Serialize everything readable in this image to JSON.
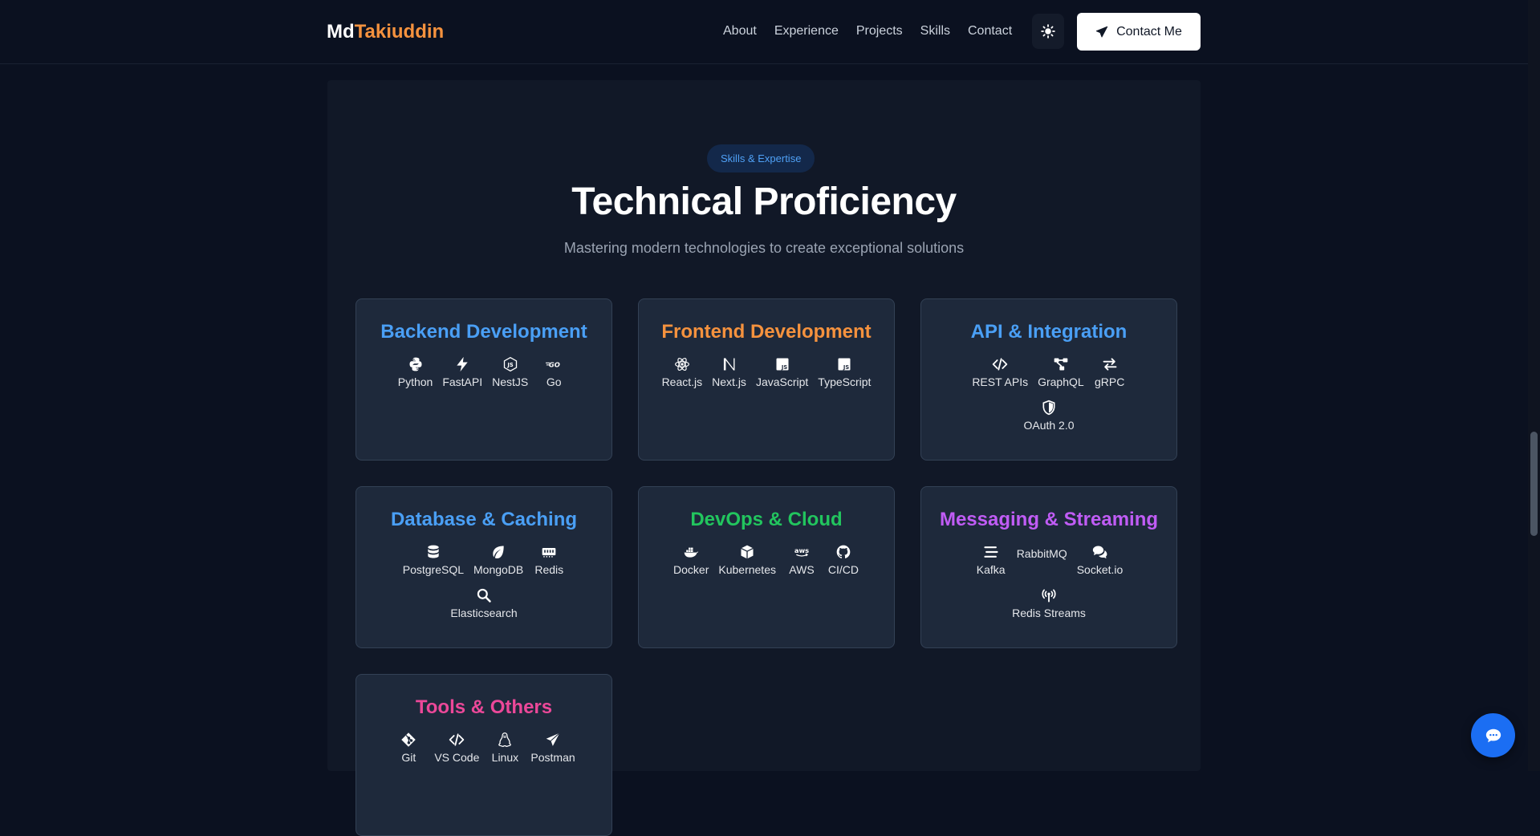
{
  "header": {
    "brand_first": "Md",
    "brand_last": "Takiuddin",
    "nav": [
      "About",
      "Experience",
      "Projects",
      "Skills",
      "Contact"
    ],
    "theme_icon": "sun-icon",
    "contact_label": "Contact Me",
    "contact_icon": "paper-plane-icon"
  },
  "section": {
    "badge": "Skills & Expertise",
    "title": "Technical Proficiency",
    "subtitle": "Mastering modern technologies to create exceptional solutions"
  },
  "colors": {
    "blue": "#4a9ff5",
    "orange": "#f5923e",
    "green": "#22c55e",
    "purple": "#c05cf5",
    "pink": "#ec4899"
  },
  "categories": [
    {
      "title": "Backend Development",
      "color": "#4a9ff5",
      "skills": [
        {
          "label": "Python",
          "icon": "python-icon"
        },
        {
          "label": "FastAPI",
          "icon": "bolt-icon"
        },
        {
          "label": "NestJS",
          "icon": "nestjs-icon"
        },
        {
          "label": "Go",
          "icon": "go-icon"
        }
      ]
    },
    {
      "title": "Frontend Development",
      "color": "#f5923e",
      "skills": [
        {
          "label": "React.js",
          "icon": "react-icon"
        },
        {
          "label": "Next.js",
          "icon": "nextjs-icon"
        },
        {
          "label": "JavaScript",
          "icon": "js-icon"
        },
        {
          "label": "TypeScript",
          "icon": "js-icon"
        }
      ]
    },
    {
      "title": "API & Integration",
      "color": "#4a9ff5",
      "skills": [
        {
          "label": "REST APIs",
          "icon": "code-icon"
        },
        {
          "label": "GraphQL",
          "icon": "diagram-icon"
        },
        {
          "label": "gRPC",
          "icon": "arrows-exchange-icon"
        },
        {
          "label": "OAuth 2.0",
          "icon": "shield-icon"
        }
      ]
    },
    {
      "title": "Database & Caching",
      "color": "#4a9ff5",
      "skills": [
        {
          "label": "PostgreSQL",
          "icon": "database-icon"
        },
        {
          "label": "MongoDB",
          "icon": "leaf-icon"
        },
        {
          "label": "Redis",
          "icon": "memory-icon"
        },
        {
          "label": "Elasticsearch",
          "icon": "search-icon"
        }
      ]
    },
    {
      "title": "DevOps & Cloud",
      "color": "#22c55e",
      "skills": [
        {
          "label": "Docker",
          "icon": "docker-icon"
        },
        {
          "label": "Kubernetes",
          "icon": "cube-icon"
        },
        {
          "label": "AWS",
          "icon": "aws-icon"
        },
        {
          "label": "CI/CD",
          "icon": "github-icon"
        }
      ]
    },
    {
      "title": "Messaging & Streaming",
      "color": "#c05cf5",
      "skills": [
        {
          "label": "Kafka",
          "icon": "stream-icon"
        },
        {
          "label": "RabbitMQ",
          "icon": ""
        },
        {
          "label": "Socket.io",
          "icon": "comments-icon"
        },
        {
          "label": "Redis Streams",
          "icon": "broadcast-icon"
        }
      ]
    },
    {
      "title": "Tools & Others",
      "color": "#ec4899",
      "skills": [
        {
          "label": "Git",
          "icon": "git-icon"
        },
        {
          "label": "VS Code",
          "icon": "code-icon"
        },
        {
          "label": "Linux",
          "icon": "linux-icon"
        },
        {
          "label": "Postman",
          "icon": "paper-plane-icon"
        }
      ]
    }
  ],
  "chat_icon": "chat-icon"
}
